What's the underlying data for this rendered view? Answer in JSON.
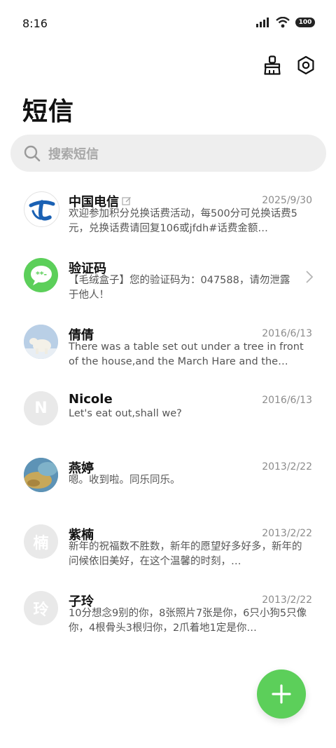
{
  "status_bar": {
    "time": "8:16",
    "battery": "100"
  },
  "header": {
    "title": "短信"
  },
  "search": {
    "placeholder": "搜索短信"
  },
  "colors": {
    "accent": "#5ccf5a",
    "telecom_blue": "#1a61b4"
  },
  "conversations": [
    {
      "name": "中国电信",
      "date": "2025/9/30",
      "preview": "欢迎参加积分兑换话费活动，每500分可兑换话费5元，兑换话费请回复106或jfdh#话费金额…"
    },
    {
      "name": "验证码",
      "date": "",
      "preview": "【毛绒盒子】您的验证码为：047588，请勿泄露于他人！"
    },
    {
      "name": "倩倩",
      "date": "2016/6/13",
      "preview": "There was a table set out under a tree in front of the house,and the March Hare and the Hatte…"
    },
    {
      "name": "Nicole",
      "date": "2016/6/13",
      "preview": "Let's eat out,shall we?",
      "initial": "N"
    },
    {
      "name": "燕婷",
      "date": "2013/2/22",
      "preview": "嗯。收到啦。同乐同乐。"
    },
    {
      "name": "紫楠",
      "date": "2013/2/22",
      "preview": "新年的祝福数不胜数，新年的愿望好多好多，新年的问候依旧美好，在这个温馨的时刻，…",
      "initial": "楠"
    },
    {
      "name": "子玲",
      "date": "2013/2/22",
      "preview": "10分想念9别的你，8张照片7张是你，6只小狗5只像你，4根骨头3根归你，2爪着地1定是你…",
      "initial": "玲"
    }
  ]
}
